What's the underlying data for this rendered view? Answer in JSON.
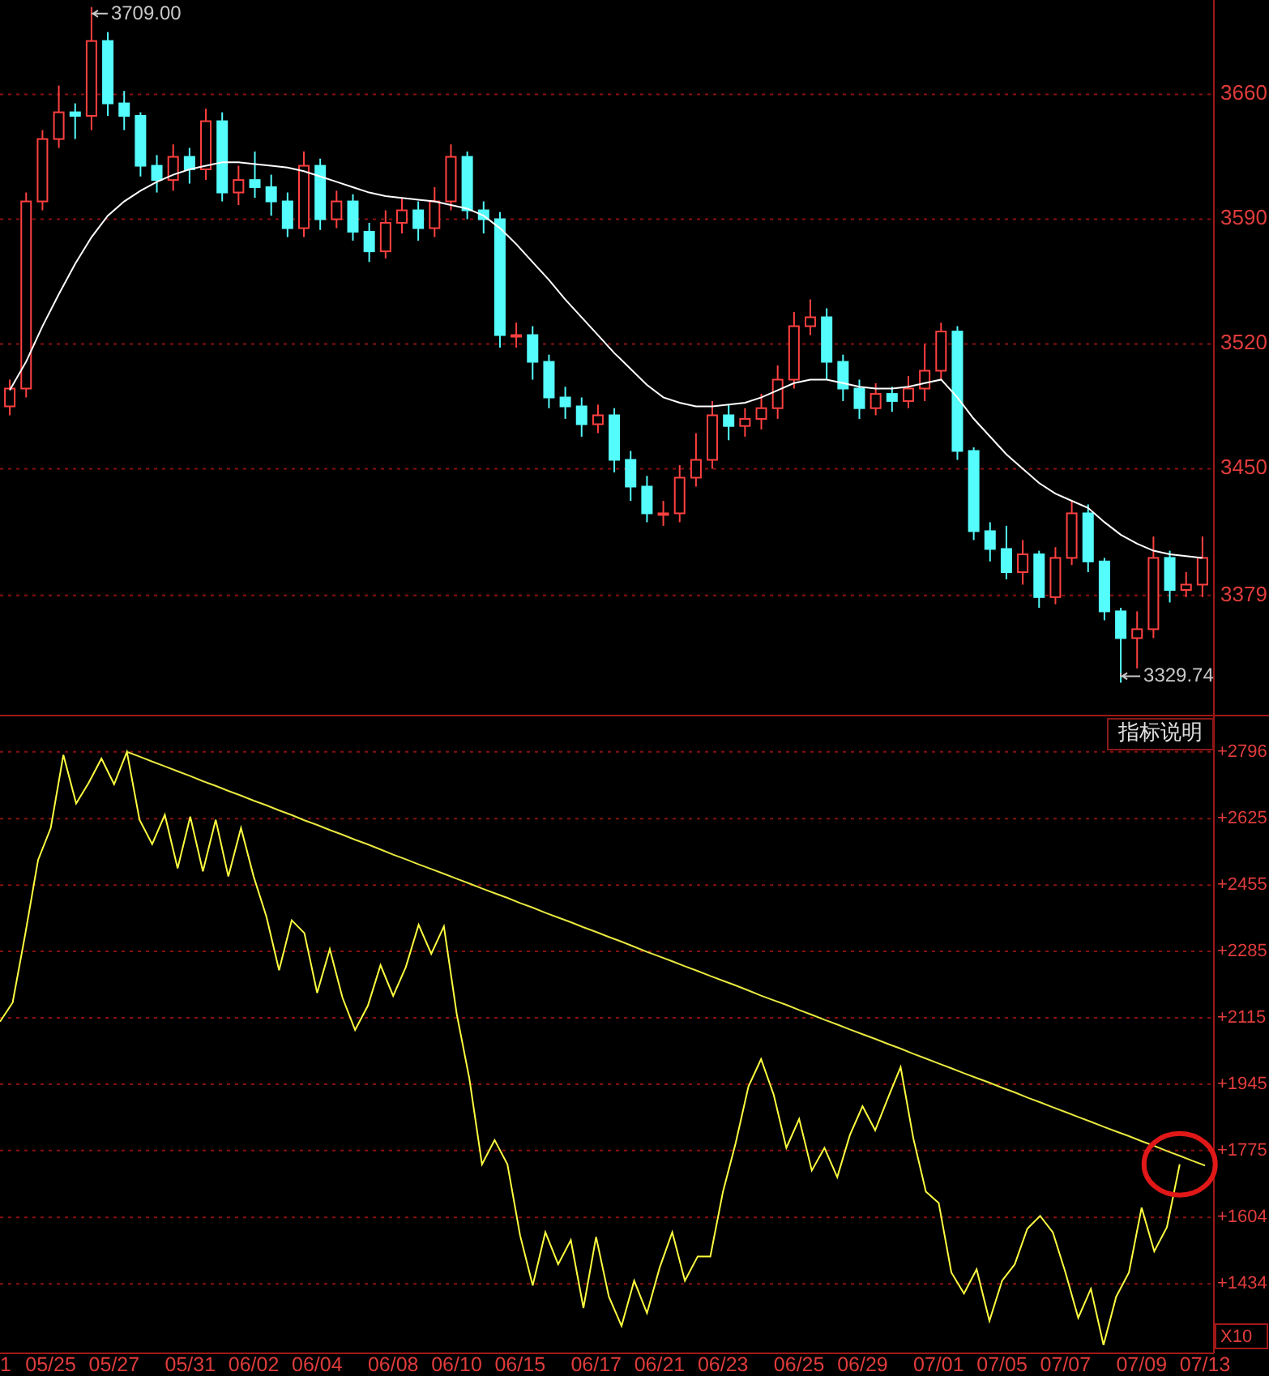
{
  "price_chart": {
    "chart_data": {
      "type": "candlestick",
      "grid": true,
      "ylim": [
        3312,
        3713
      ],
      "yticks": [
        3660,
        3590,
        3520,
        3450,
        3379
      ],
      "categories": [
        null,
        null,
        null,
        null,
        null,
        null,
        null,
        null,
        null,
        null,
        null,
        null,
        null,
        null,
        null,
        null,
        null,
        null,
        null,
        null,
        null,
        null,
        null,
        null,
        null,
        null,
        null,
        null,
        null,
        null,
        null,
        null,
        null,
        null,
        null,
        null,
        null,
        null,
        null,
        null,
        null,
        null,
        null,
        null,
        null,
        null,
        null,
        null,
        null,
        null,
        null,
        null,
        null,
        null,
        null,
        null,
        null,
        null,
        null,
        null,
        null,
        null,
        null,
        null,
        null,
        null,
        null,
        null,
        null,
        null,
        null,
        null,
        null,
        null
      ],
      "ohlc": [
        [
          3485,
          3500,
          3480,
          3495
        ],
        [
          3495,
          3605,
          3490,
          3600
        ],
        [
          3600,
          3640,
          3595,
          3635
        ],
        [
          3635,
          3665,
          3630,
          3650
        ],
        [
          3650,
          3655,
          3635,
          3648
        ],
        [
          3648,
          3709,
          3640,
          3690
        ],
        [
          3690,
          3695,
          3648,
          3655
        ],
        [
          3655,
          3662,
          3640,
          3648
        ],
        [
          3648,
          3650,
          3614,
          3620
        ],
        [
          3620,
          3626,
          3605,
          3612
        ],
        [
          3612,
          3632,
          3606,
          3625
        ],
        [
          3625,
          3630,
          3610,
          3618
        ],
        [
          3618,
          3652,
          3612,
          3645
        ],
        [
          3645,
          3650,
          3600,
          3605
        ],
        [
          3605,
          3620,
          3598,
          3612
        ],
        [
          3612,
          3628,
          3602,
          3608
        ],
        [
          3608,
          3615,
          3592,
          3600
        ],
        [
          3600,
          3605,
          3580,
          3585
        ],
        [
          3585,
          3628,
          3580,
          3620
        ],
        [
          3620,
          3624,
          3584,
          3590
        ],
        [
          3590,
          3606,
          3585,
          3600
        ],
        [
          3600,
          3604,
          3578,
          3583
        ],
        [
          3583,
          3588,
          3566,
          3572
        ],
        [
          3572,
          3595,
          3568,
          3588
        ],
        [
          3588,
          3602,
          3582,
          3595
        ],
        [
          3595,
          3600,
          3578,
          3585
        ],
        [
          3585,
          3608,
          3580,
          3600
        ],
        [
          3600,
          3632,
          3595,
          3625
        ],
        [
          3625,
          3628,
          3590,
          3595
        ],
        [
          3595,
          3600,
          3582,
          3590
        ],
        [
          3590,
          3594,
          3518,
          3525
        ],
        [
          3525,
          3532,
          3518,
          3525
        ],
        [
          3525,
          3530,
          3500,
          3510
        ],
        [
          3510,
          3514,
          3484,
          3490
        ],
        [
          3490,
          3496,
          3478,
          3485
        ],
        [
          3485,
          3490,
          3468,
          3475
        ],
        [
          3475,
          3486,
          3470,
          3480
        ],
        [
          3480,
          3484,
          3448,
          3455
        ],
        [
          3455,
          3460,
          3432,
          3440
        ],
        [
          3440,
          3446,
          3420,
          3425
        ],
        [
          3425,
          3432,
          3418,
          3425
        ],
        [
          3425,
          3452,
          3420,
          3445
        ],
        [
          3445,
          3470,
          3440,
          3455
        ],
        [
          3455,
          3488,
          3450,
          3480
        ],
        [
          3480,
          3486,
          3466,
          3474
        ],
        [
          3474,
          3484,
          3468,
          3478
        ],
        [
          3478,
          3492,
          3472,
          3484
        ],
        [
          3484,
          3508,
          3478,
          3500
        ],
        [
          3500,
          3538,
          3495,
          3530
        ],
        [
          3530,
          3545,
          3525,
          3535
        ],
        [
          3535,
          3540,
          3500,
          3510
        ],
        [
          3510,
          3514,
          3488,
          3495
        ],
        [
          3495,
          3500,
          3478,
          3484
        ],
        [
          3484,
          3498,
          3480,
          3492
        ],
        [
          3492,
          3496,
          3482,
          3488
        ],
        [
          3488,
          3502,
          3484,
          3495
        ],
        [
          3495,
          3520,
          3488,
          3505
        ],
        [
          3505,
          3532,
          3500,
          3527
        ],
        [
          3527,
          3530,
          3455,
          3460
        ],
        [
          3460,
          3462,
          3410,
          3415
        ],
        [
          3415,
          3420,
          3398,
          3405
        ],
        [
          3405,
          3418,
          3388,
          3392
        ],
        [
          3392,
          3410,
          3385,
          3402
        ],
        [
          3402,
          3404,
          3372,
          3378
        ],
        [
          3378,
          3406,
          3374,
          3400
        ],
        [
          3400,
          3432,
          3396,
          3425
        ],
        [
          3425,
          3430,
          3392,
          3398
        ],
        [
          3398,
          3400,
          3365,
          3370
        ],
        [
          3370,
          3372,
          3330,
          3355
        ],
        [
          3355,
          3370,
          3338,
          3360
        ],
        [
          3360,
          3412,
          3355,
          3400
        ],
        [
          3400,
          3404,
          3375,
          3382
        ],
        [
          3382,
          3392,
          3378,
          3385
        ],
        [
          3385,
          3412,
          3378,
          3400
        ]
      ],
      "series": [
        {
          "type": "line",
          "color": "#ffffff",
          "values": [
            3494,
            3510,
            3530,
            3548,
            3565,
            3580,
            3592,
            3600,
            3606,
            3611,
            3615,
            3618,
            3620,
            3622,
            3622,
            3621,
            3620,
            3619,
            3617,
            3614,
            3611,
            3608,
            3605,
            3603,
            3602,
            3601,
            3600,
            3598,
            3596,
            3592,
            3585,
            3576,
            3566,
            3556,
            3545,
            3535,
            3525,
            3515,
            3506,
            3497,
            3490,
            3487,
            3485,
            3485,
            3486,
            3487,
            3490,
            3494,
            3498,
            3500,
            3500,
            3498,
            3496,
            3495,
            3495,
            3496,
            3498,
            3500,
            3490,
            3478,
            3468,
            3458,
            3450,
            3442,
            3436,
            3432,
            3428,
            3420,
            3413,
            3408,
            3404,
            3402,
            3401,
            3400
          ]
        }
      ],
      "annotations": [
        "3709.00",
        "3329.74"
      ]
    }
  },
  "indicator_chart": {
    "button": "指标说明",
    "scale_label": "X10",
    "chart_data": {
      "type": "line",
      "grid": true,
      "ylim": [
        1256,
        2891
      ],
      "categories": [
        "1",
        null,
        null,
        null,
        "05/25",
        null,
        null,
        null,
        null,
        "05/27",
        null,
        null,
        null,
        null,
        null,
        "05/31",
        null,
        null,
        null,
        null,
        "06/02",
        null,
        null,
        null,
        null,
        "06/04",
        null,
        null,
        null,
        null,
        null,
        "06/08",
        null,
        null,
        null,
        null,
        "06/10",
        null,
        null,
        null,
        null,
        "06/15",
        null,
        null,
        null,
        null,
        null,
        "06/17",
        null,
        null,
        null,
        null,
        "06/21",
        null,
        null,
        null,
        null,
        "06/23",
        null,
        null,
        null,
        null,
        null,
        "06/25",
        null,
        null,
        null,
        null,
        "06/29",
        null,
        null,
        null,
        null,
        null,
        "07/01",
        null,
        null,
        null,
        null,
        "07/05",
        null,
        null,
        null,
        null,
        "07/07",
        null,
        null,
        null,
        null,
        null,
        "07/09",
        null,
        null,
        null,
        null,
        "07/13"
      ],
      "yticks": [
        {
          "value": 2796,
          "label": "+2796"
        },
        {
          "value": 2625,
          "label": "+2625"
        },
        {
          "value": 2455,
          "label": "+2455"
        },
        {
          "value": 2285,
          "label": "+2285"
        },
        {
          "value": 2115,
          "label": "+2115"
        },
        {
          "value": 1945,
          "label": "+1945"
        },
        {
          "value": 1775,
          "label": "+1775"
        },
        {
          "value": 1604,
          "label": "+1604"
        },
        {
          "value": 1434,
          "label": "+1434"
        }
      ],
      "series": [
        {
          "color": "#ffff40",
          "values": [
            2105,
            2154,
            2332,
            2519,
            2601,
            2788,
            2664,
            2717,
            2779,
            2713,
            2796,
            2622,
            2560,
            2635,
            2498,
            2630,
            2490,
            2622,
            2477,
            2601,
            2477,
            2374,
            2237,
            2365,
            2332,
            2179,
            2291,
            2167,
            2084,
            2146,
            2250,
            2171,
            2245,
            2353,
            2279,
            2349,
            2125,
            1960,
            1740,
            1802,
            1740,
            1558,
            1430,
            1566,
            1484,
            1546,
            1372,
            1554,
            1401,
            1326,
            1442,
            1359,
            1475,
            1566,
            1442,
            1504,
            1504,
            1670,
            1794,
            1939,
            2009,
            1918,
            1782,
            1856,
            1724,
            1782,
            1707,
            1815,
            1889,
            1827,
            1910,
            1989,
            1807,
            1670,
            1641,
            1463,
            1409,
            1471,
            1339,
            1442,
            1484,
            1575,
            1608,
            1566,
            1463,
            1347,
            1421,
            1277,
            1401,
            1463,
            1629,
            1517,
            1579,
            1740,
            null,
            null
          ]
        },
        {
          "color": "#e8e840",
          "values": [
            null,
            null,
            null,
            null,
            null,
            null,
            null,
            null,
            null,
            null,
            2796,
            2784,
            2771,
            2759,
            2746,
            2734,
            2721,
            2709,
            2696,
            2684,
            2671,
            2659,
            2646,
            2634,
            2621,
            2609,
            2596,
            2584,
            2571,
            2559,
            2546,
            2533,
            2521,
            2508,
            2496,
            2484,
            2471,
            2459,
            2446,
            2434,
            2422,
            2409,
            2397,
            2384,
            2372,
            2360,
            2347,
            2335,
            2322,
            2310,
            2297,
            2284,
            2272,
            2260,
            2247,
            2235,
            2222,
            2210,
            2198,
            2185,
            2172,
            2160,
            2148,
            2135,
            2123,
            2110,
            2098,
            2085,
            2073,
            2061,
            2048,
            2036,
            2023,
            2011,
            1998,
            1986,
            1973,
            1961,
            1949,
            1936,
            1924,
            1911,
            1899,
            1886,
            1874,
            1861,
            1849,
            1836,
            1824,
            1812,
            1799,
            1787,
            1774,
            1762,
            1749,
            1737
          ]
        }
      ]
    }
  }
}
